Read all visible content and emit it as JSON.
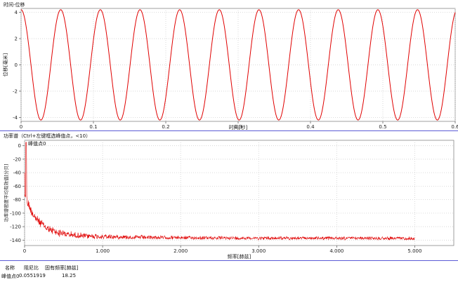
{
  "chart_data": [
    {
      "type": "line",
      "title": "时间-位移",
      "xlabel": "时间[秒]",
      "ylabel": "位移[毫米]",
      "xlim": [
        0,
        0.6
      ],
      "ylim": [
        -4.3,
        4.3
      ],
      "x_ticks": [
        "0",
        "0.1",
        "0.2",
        "0.3",
        "0.4",
        "0.5",
        "0.6"
      ],
      "y_ticks": [
        "4",
        "2",
        "0",
        "-2",
        "-4"
      ],
      "grid": true,
      "series": [
        {
          "color": "#e00000",
          "amplitude": 4.2,
          "frequency": 18.25,
          "x_start": 0,
          "x_end": 0.6
        }
      ]
    },
    {
      "type": "line",
      "title": "功率谱（Ctrl+左键框选峰值点，<10）",
      "xlabel": "频率[赫兹]",
      "ylabel": "功率谱密度平均有效值[分贝]",
      "xlim": [
        0,
        5500
      ],
      "ylim": [
        -148,
        8
      ],
      "x_ticks": [
        "0",
        "1.000",
        "2.000",
        "3.000",
        "4.000",
        "5.000"
      ],
      "y_ticks": [
        "0",
        "-20",
        "-40",
        "-60",
        "-80",
        "-100",
        "-120",
        "-140"
      ],
      "grid": true,
      "annotations": [
        {
          "text": "峰值点0",
          "x": 18.25,
          "y": 5
        }
      ],
      "series": [
        {
          "color": "#e00000",
          "x_end": 5000,
          "peak_x": 18.25,
          "peak_y": 5,
          "floor_y": -136
        }
      ]
    }
  ],
  "table": {
    "headers": [
      "名称",
      "阻尼比",
      "固有频率[赫兹]"
    ],
    "rows": [
      [
        "峰值点0",
        "0.0551919",
        "18.25"
      ]
    ]
  }
}
